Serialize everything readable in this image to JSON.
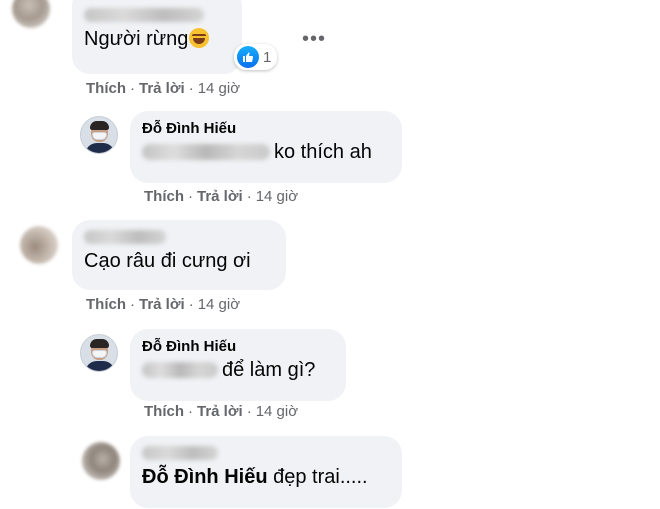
{
  "actions": {
    "like": "Thích",
    "reply": "Trả lời",
    "sep": "·"
  },
  "comments": [
    {
      "text": "Người rừng",
      "emoji": "laughing-tears",
      "reactions": {
        "type": "like",
        "count": "1"
      },
      "time": "14 giờ"
    },
    {
      "author": "Đỗ Đình Hiếu",
      "text": "ko thích ah",
      "time": "14 giờ"
    },
    {
      "text": "Cạo râu đi cưng ơi",
      "time": "14 giờ"
    },
    {
      "author": "Đỗ Đình Hiếu",
      "text": "để làm gì?",
      "time": "14 giờ"
    },
    {
      "mention": "Đỗ Đình Hiếu",
      "text": "đẹp trai....."
    }
  ],
  "more_glyph": "•••"
}
